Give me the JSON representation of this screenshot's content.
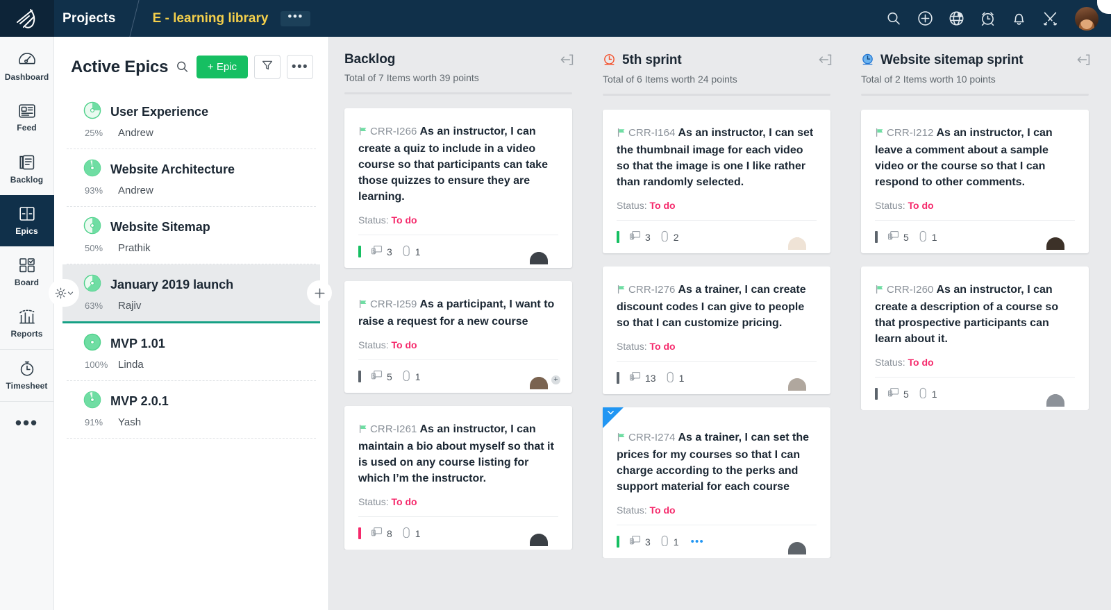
{
  "topbar": {
    "logo_icon": "zoho-sprints-logo-icon",
    "projects_label": "Projects",
    "project_name": "E - learning library",
    "overflow_label": "•••",
    "icons": [
      {
        "name": "search-icon"
      },
      {
        "name": "add-circle-icon"
      },
      {
        "name": "globe-icon"
      },
      {
        "name": "alarm-clock-icon"
      },
      {
        "name": "bell-icon"
      },
      {
        "name": "tools-icon"
      }
    ]
  },
  "sidebar": {
    "items": [
      {
        "label": "Dashboard",
        "icon": "dashboard-icon",
        "active": false
      },
      {
        "label": "Feed",
        "icon": "feed-icon",
        "active": false
      },
      {
        "label": "Backlog",
        "icon": "backlog-icon",
        "active": false
      },
      {
        "label": "Epics",
        "icon": "epics-icon",
        "active": true
      },
      {
        "label": "Board",
        "icon": "board-icon",
        "active": false
      },
      {
        "label": "Reports",
        "icon": "reports-icon",
        "active": false
      },
      {
        "label": "Timesheet",
        "icon": "timesheet-icon",
        "active": false
      }
    ],
    "more_label": "•••"
  },
  "epics": {
    "title": "Active Epics",
    "search_icon": "search-icon",
    "add_button": "+ Epic",
    "filter_icon": "filter-icon",
    "more_icon": "more-dots-icon",
    "gear_icon": "gear-icon",
    "add_child_icon": "plus-icon",
    "list": [
      {
        "name": "User Experience",
        "percent": "25%",
        "progress": 25,
        "owner": "Andrew",
        "selected": false
      },
      {
        "name": "Website Architecture",
        "percent": "93%",
        "progress": 93,
        "owner": "Andrew",
        "selected": false
      },
      {
        "name": "Website Sitemap",
        "percent": "50%",
        "progress": 50,
        "owner": "Prathik",
        "selected": false
      },
      {
        "name": "January 2019 launch",
        "percent": "63%",
        "progress": 63,
        "owner": "Rajiv",
        "selected": true
      },
      {
        "name": "MVP 1.01",
        "percent": "100%",
        "progress": 100,
        "owner": "Linda",
        "selected": false
      },
      {
        "name": "MVP 2.0.1",
        "percent": "91%",
        "progress": 91,
        "owner": "Yash",
        "selected": false
      }
    ]
  },
  "board": {
    "columns": [
      {
        "title": "Backlog",
        "icon": null,
        "subtitle": "Total of 7 Items worth 39 points",
        "collapse_icon": "collapse-left-icon",
        "cards": [
          {
            "id": "CRR-I266",
            "title": "As an instructor, I can create a quiz to include in a video course so that participants can take those quizzes to ensure they are learning.",
            "status_label": "Status:",
            "status_value": "To do",
            "priority_color": "#16bf62",
            "comments": "3",
            "attachments": "1",
            "ribbon": false,
            "more_dots": false,
            "avatar_plus": false,
            "avatar_colors": [
              "#5b6066",
              "#c9ccd0",
              "#3d4248"
            ]
          },
          {
            "id": "CRR-I259",
            "title": "As a participant, I want to raise a request for a new course",
            "status_label": "Status:",
            "status_value": "To do",
            "priority_color": "#5c646c",
            "comments": "5",
            "attachments": "1",
            "ribbon": false,
            "more_dots": false,
            "avatar_plus": true,
            "avatar_colors": [
              "#2c3138",
              "#7a6350",
              "#1f242a"
            ]
          },
          {
            "id": "CRR-I261",
            "title": "As an instructor, I can maintain a bio about myself so that it is used on any course listing for which I’m the instructor.",
            "status_label": "Status:",
            "status_value": "To do",
            "priority_color": "#f5296b",
            "comments": "8",
            "attachments": "1",
            "ribbon": false,
            "more_dots": false,
            "avatar_plus": false,
            "avatar_colors": [
              "#55595f",
              "#d8d4cf",
              "#3a3f45"
            ]
          }
        ]
      },
      {
        "title": "5th sprint",
        "icon": "clock-active-icon",
        "icon_color": "#f4512c",
        "subtitle": "Total of 6 Items worth 24 points",
        "collapse_icon": "collapse-left-icon",
        "cards": [
          {
            "id": "CRR-I164",
            "title": "As an instructor, I can set the thumbnail image for each video so that the image is one I like rather than randomly selected.",
            "status_label": "Status:",
            "status_value": "To do",
            "priority_color": "#16bf62",
            "comments": "3",
            "attachments": "2",
            "ribbon": false,
            "more_dots": false,
            "avatar_plus": false,
            "avatar_colors": [
              "#7a4a2c",
              "#3a2418",
              "#b07248"
            ]
          },
          {
            "id": "CRR-I276",
            "title": "As a trainer, I can create discount codes I can give to people so that I can customize pricing.",
            "status_label": "Status:",
            "status_value": "To do",
            "priority_color": "#5c646c",
            "comments": "13",
            "attachments": "1",
            "ribbon": false,
            "more_dots": false,
            "avatar_plus": false,
            "avatar_colors": [
              "#b0a79e",
              "#efe7dd",
              "#8d7a68"
            ]
          },
          {
            "id": "CRR-I274",
            "title": "As a trainer, I can set the prices for my courses so that I can charge according to the perks and support material for each course",
            "status_label": "Status:",
            "status_value": "To do",
            "priority_color": "#16bf62",
            "comments": "3",
            "attachments": "1",
            "ribbon": true,
            "ribbon_color": "#2196f3",
            "more_dots": true,
            "more_dots_label": "•••",
            "avatar_plus": false,
            "avatar_colors": [
              "#8e9499",
              "#d7d2c9",
              "#5e646a"
            ]
          }
        ]
      },
      {
        "title": "Website sitemap sprint",
        "icon": "clock-filled-icon",
        "icon_color": "#2477d4",
        "subtitle": "Total of 2 Items worth 10 points",
        "collapse_icon": "collapse-left-icon",
        "cards": [
          {
            "id": "CRR-I212",
            "title": "As an instructor, I can leave a comment about a sample video or the course so that I can respond to other comments.",
            "status_label": "Status:",
            "status_value": "To do",
            "priority_color": "#5c646c",
            "comments": "5",
            "attachments": "1",
            "ribbon": false,
            "more_dots": false,
            "avatar_plus": false,
            "avatar_colors": [
              "#3c3128",
              "#1d1712",
              "#6b5645"
            ]
          },
          {
            "id": "CRR-I260",
            "title": "As an instructor, I can create a description of a course so that prospective participants can learn about it.",
            "status_label": "Status:",
            "status_value": "To do",
            "priority_color": "#5c646c",
            "comments": "5",
            "attachments": "1",
            "ribbon": false,
            "more_dots": false,
            "avatar_plus": false,
            "avatar_colors": [
              "#8d9299",
              "#cfd3d7",
              "#5a6169"
            ]
          }
        ]
      }
    ]
  },
  "colors": {
    "brand_dark": "#10304a",
    "accent_green": "#16bf62",
    "accent_yellow": "#f4cf4b",
    "status_red": "#f5296b",
    "ribbon_blue": "#2196f3",
    "board_bg": "#e9eaec"
  }
}
